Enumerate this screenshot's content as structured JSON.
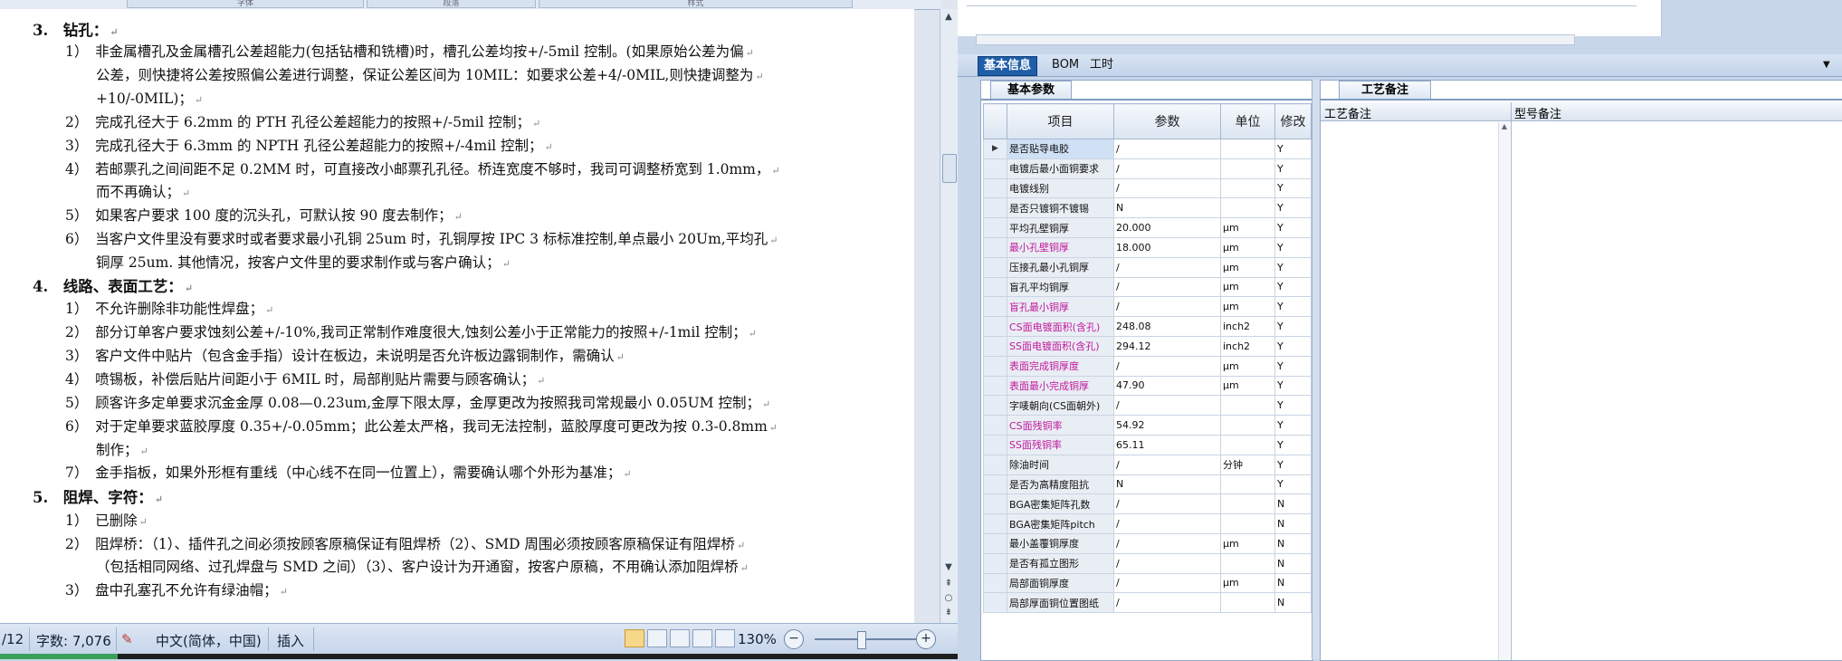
{
  "word": {
    "ribbon_groups": [
      "字体",
      "段落",
      "样式"
    ],
    "lines": [
      {
        "text": "3.　钻孔：",
        "sec": true
      },
      {
        "text": "1）　非金属槽孔及金属槽孔公差超能力(包括钻槽和铣槽)时，槽孔公差均按+/-5mil 控制。(如果原始公差为偏"
      },
      {
        "text": "公差，则快捷将公差按照偏公差进行调整，保证公差区间为 10MIL：如要求公差+4/-0MIL,则快捷调整为"
      },
      {
        "text": "+10/-0MIL)；"
      },
      {
        "text": "2）　完成孔径大于 6.2mm 的 PTH 孔径公差超能力的按照+/-5mil 控制；"
      },
      {
        "text": "3）　完成孔径大于 6.3mm 的 NPTH 孔径公差超能力的按照+/-4mil 控制；"
      },
      {
        "text": "4）　若邮票孔之间间距不足 0.2MM 时，可直接改小邮票孔孔径。桥连宽度不够时，我司可调整桥宽到 1.0mm，"
      },
      {
        "text": "而不再确认；"
      },
      {
        "text": "5）　如果客户要求 100 度的沉头孔，可默认按 90 度去制作；"
      },
      {
        "text": "6）　当客户文件里没有要求时或者要求最小孔铜 25um 时，孔铜厚按 IPC 3 标标准控制,单点最小 20Um,平均孔"
      },
      {
        "text": "铜厚 25um. 其他情况，按客户文件里的要求制作或与客户确认；"
      },
      {
        "text": "4.　线路、表面工艺：",
        "sec": true
      },
      {
        "text": "1）　不允许删除非功能性焊盘；"
      },
      {
        "text": "2）　部分订单客户要求蚀刻公差+/-10%,我司正常制作难度很大,蚀刻公差小于正常能力的按照+/-1mil 控制；"
      },
      {
        "text": "3）　客户文件中贴片（包含金手指）设计在板边，未说明是否允许板边露铜制作，需确认"
      },
      {
        "text": "4）　喷锡板，补偿后贴片间距小于 6MIL 时，局部削贴片需要与顾客确认；"
      },
      {
        "text": "5）　顾客许多定单要求沉金金厚 0.08—0.23um,金厚下限太厚，金厚更改为按照我司常规最小 0.05UM 控制；"
      },
      {
        "text": "6）　对于定单要求蓝胶厚度 0.35+/-0.05mm；此公差太严格，我司无法控制，蓝胶厚度可更改为按 0.3-0.8mm"
      },
      {
        "text": "制作；"
      },
      {
        "text": "7）　金手指板，如果外形框有重线（中心线不在同一位置上），需要确认哪个外形为基准；"
      },
      {
        "text": "5.　阻焊、字符：",
        "sec": true
      },
      {
        "text": "1）　已删除"
      },
      {
        "text": "2）　阻焊桥：（1）、插件孔之间必须按顾客原稿保证有阻焊桥（2）、SMD 周围必须按顾客原稿保证有阻焊桥"
      },
      {
        "text": "（包括相同网络、过孔焊盘与 SMD 之间）（3）、客户设计为开通窗，按客户原稿，不用确认添加阻焊桥"
      },
      {
        "text": "3）　盘中孔塞孔不允许有绿油帽；"
      }
    ],
    "status": {
      "page": "/12",
      "words": "字数: 7,076",
      "language": "中文(简体，中国)",
      "mode": "插入",
      "zoom": "130%",
      "zoom_minus": "−",
      "zoom_plus": "+"
    }
  },
  "app": {
    "outer_tabs": [
      "基本信息",
      "BOM",
      "工时"
    ],
    "left_tab": "基本参数",
    "right_tab": "工艺备注",
    "columns": [
      "项目",
      "参数",
      "单位",
      "修改"
    ],
    "rows": [
      {
        "item": "是否贴导电胶",
        "param": "/",
        "unit": "",
        "mod": "Y",
        "pink": false
      },
      {
        "item": "电镀后最小面铜要求",
        "param": "/",
        "unit": "",
        "mod": "Y",
        "pink": false
      },
      {
        "item": "电镀线别",
        "param": "/",
        "unit": "",
        "mod": "Y",
        "pink": false
      },
      {
        "item": "是否只镀铜不镀锡",
        "param": "N",
        "unit": "",
        "mod": "Y",
        "pink": false
      },
      {
        "item": "平均孔壁铜厚",
        "param": "20.000",
        "unit": "μm",
        "mod": "Y",
        "pink": false
      },
      {
        "item": "最小孔壁铜厚",
        "param": "18.000",
        "unit": "μm",
        "mod": "Y",
        "pink": true
      },
      {
        "item": "压接孔最小孔铜厚",
        "param": "/",
        "unit": "μm",
        "mod": "Y",
        "pink": false
      },
      {
        "item": "盲孔平均铜厚",
        "param": "/",
        "unit": "μm",
        "mod": "Y",
        "pink": false
      },
      {
        "item": "盲孔最小铜厚",
        "param": "/",
        "unit": "μm",
        "mod": "Y",
        "pink": true
      },
      {
        "item": "CS面电镀面积(含孔)",
        "param": "248.08",
        "unit": "inch2",
        "mod": "Y",
        "pink": true
      },
      {
        "item": "SS面电镀面积(含孔)",
        "param": "294.12",
        "unit": "inch2",
        "mod": "Y",
        "pink": true
      },
      {
        "item": "表面完成铜厚度",
        "param": "/",
        "unit": "μm",
        "mod": "Y",
        "pink": true
      },
      {
        "item": "表面最小完成铜厚",
        "param": "47.90",
        "unit": "μm",
        "mod": "Y",
        "pink": true
      },
      {
        "item": "字唛朝向(CS面朝外)",
        "param": "/",
        "unit": "",
        "mod": "Y",
        "pink": false
      },
      {
        "item": "CS面残铜率",
        "param": "54.92",
        "unit": "",
        "mod": "Y",
        "pink": true
      },
      {
        "item": "SS面残铜率",
        "param": "65.11",
        "unit": "",
        "mod": "Y",
        "pink": true
      },
      {
        "item": "除油时间",
        "param": "/",
        "unit": "分钟",
        "mod": "Y",
        "pink": false
      },
      {
        "item": "是否为高精度阻抗",
        "param": "N",
        "unit": "",
        "mod": "Y",
        "pink": false
      },
      {
        "item": "BGA密集矩阵孔数",
        "param": "/",
        "unit": "",
        "mod": "N",
        "pink": false
      },
      {
        "item": "BGA密集矩阵pitch",
        "param": "/",
        "unit": "",
        "mod": "N",
        "pink": false
      },
      {
        "item": "最小盖覆铜厚度",
        "param": "/",
        "unit": "μm",
        "mod": "N",
        "pink": false
      },
      {
        "item": "是否有孤立图形",
        "param": "/",
        "unit": "",
        "mod": "N",
        "pink": false
      },
      {
        "item": "局部面铜厚度",
        "param": "/",
        "unit": "μm",
        "mod": "N",
        "pink": false
      },
      {
        "item": "局部厚面铜位置图纸",
        "param": "/",
        "unit": "",
        "mod": "N",
        "pink": false
      }
    ],
    "remarks_columns": [
      "工艺备注",
      "型号备注"
    ]
  }
}
